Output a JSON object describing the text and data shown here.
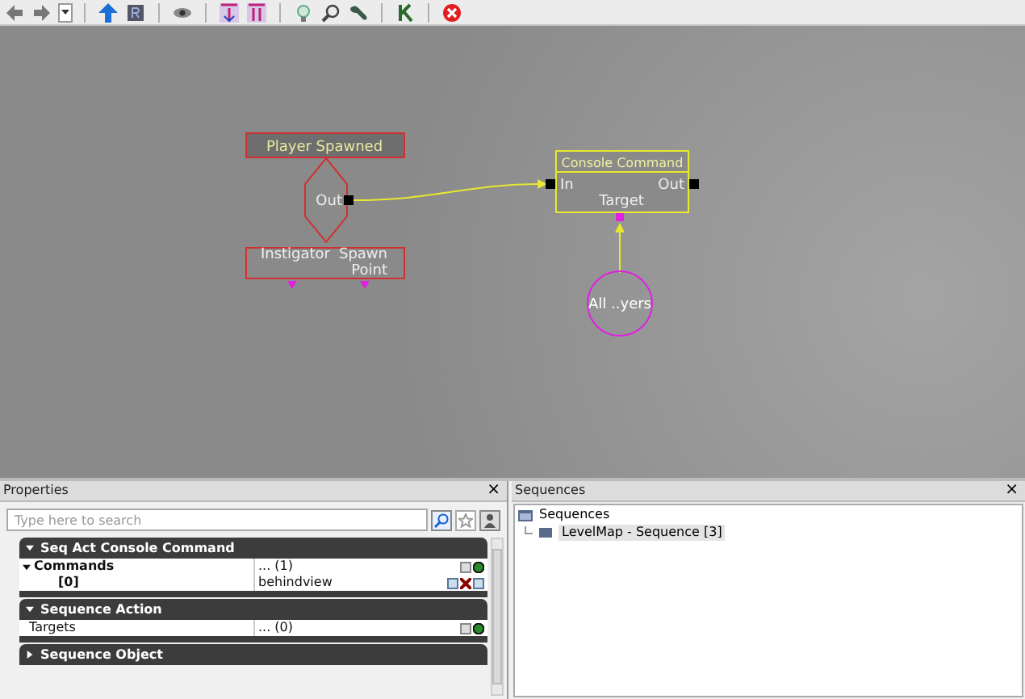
{
  "canvas": {
    "event": {
      "title": "Player Spawned",
      "output": "Out",
      "variables": [
        "Instigator",
        "Spawn Point"
      ]
    },
    "action": {
      "title": "Console Command",
      "input": "In",
      "output": "Out",
      "variable": "Target"
    },
    "variable": {
      "label": "All ..yers"
    }
  },
  "properties": {
    "title": "Properties",
    "close": "×",
    "search": {
      "placeholder": "Type here to search"
    },
    "categories": [
      {
        "title": "Seq Act Console Command",
        "expanded": true,
        "rows": [
          {
            "label": "Commands",
            "value": "... (1)",
            "expanded": true,
            "children": [
              {
                "label": "[0]",
                "value": "behindview"
              }
            ]
          }
        ]
      },
      {
        "title": "Sequence Action",
        "expanded": true,
        "rows": [
          {
            "label": "Targets",
            "value": "... (0)"
          }
        ]
      },
      {
        "title": "Sequence Object",
        "expanded": false
      }
    ]
  },
  "sequences": {
    "title": "Sequences",
    "close": "×",
    "tree": [
      {
        "label": "Sequences",
        "children": [
          {
            "label": "LevelMap - Sequence [3]",
            "selected": true
          }
        ]
      }
    ]
  }
}
